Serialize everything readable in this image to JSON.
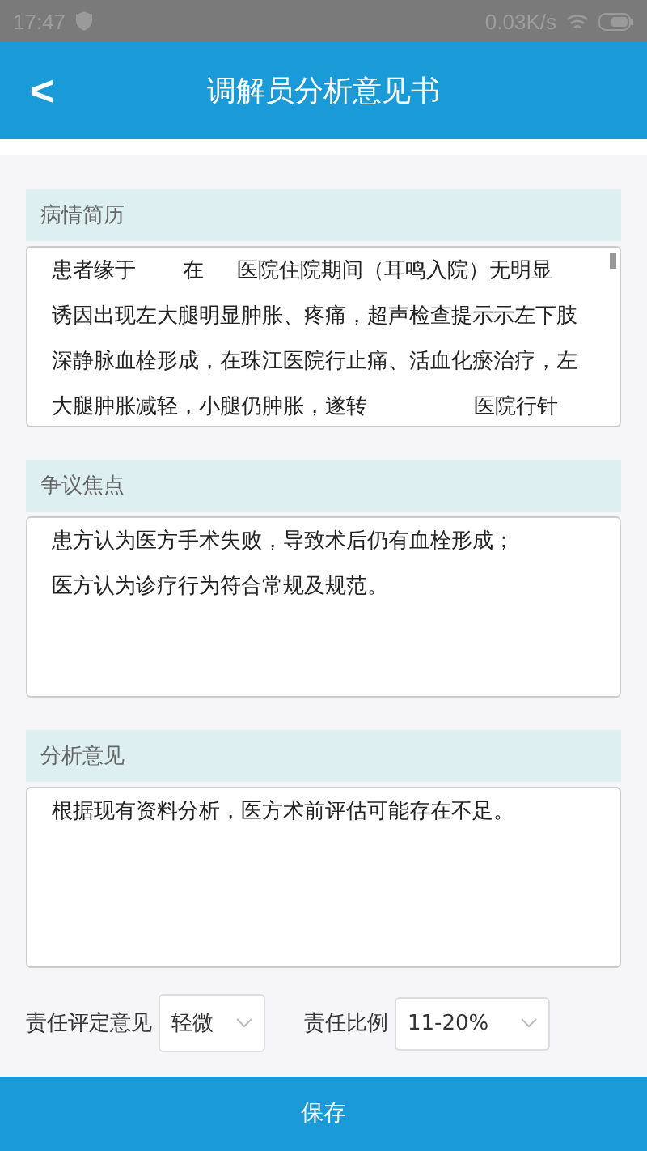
{
  "status_bar": {
    "time": "17:47",
    "speed": "0.03K/s"
  },
  "header": {
    "back": "<",
    "title": "调解员分析意见书"
  },
  "sections": [
    {
      "label": "病情简历",
      "lines": [
        "患者缘于       在     医院住院期间（耳鸣入院）无明显",
        "诱因出现左大腿明显肿胀、疼痛，超声检查提示示左下肢",
        "深静脉血栓形成，在珠江医院行止痛、活血化瘀治疗，左",
        "大腿肿胀减轻，小腿仍肿胀，遂转                医院行针"
      ],
      "scrollbar": true
    },
    {
      "label": "争议焦点",
      "lines": [
        "患方认为医方手术失败，导致术后仍有血栓形成；",
        "医方认为诊疗行为符合常规及规范。"
      ],
      "scrollbar": false
    },
    {
      "label": "分析意见",
      "lines": [
        "根据现有资料分析，医方术前评估可能存在不足。"
      ],
      "scrollbar": false
    }
  ],
  "selects": [
    {
      "label": "责任评定意见",
      "value": "轻微"
    },
    {
      "label": "责任比例",
      "value": "11-20%"
    }
  ],
  "save_button": "保存"
}
